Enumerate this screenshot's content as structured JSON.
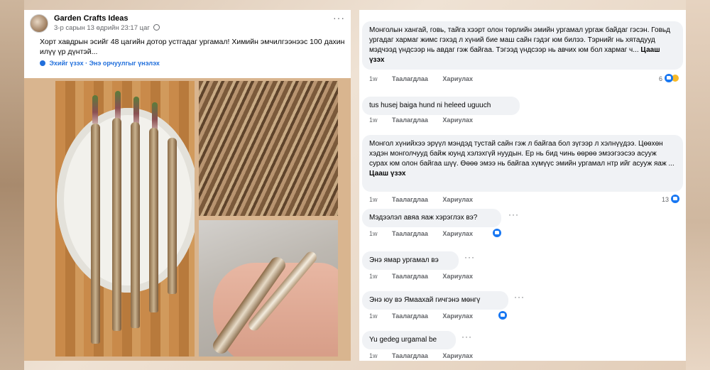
{
  "post": {
    "page_name": "Garden Crafts Ideas",
    "timestamp": "3-р сарын 13 өдрийн 23:17 цаг",
    "text": "Хорт хавдрын эсийг 48 цагийн дотор устгадаг ургамал! Химийн эмчилгээнээс 100 дахин илүү үр дүнтэй...",
    "translate_links": "Эхийг үзэх · Энэ орчуулгыг үнэлэх"
  },
  "comments": [
    {
      "text": "Монголын хангай, говь, тайга хээрт олон төрлийн эмийн ургамал ургаж байдаг гэсэн. Говьд ургадаг хармаг жимс гэхэд л хүний бие маш сайн гэдэг юм билээ. Тэрнийг нь хятадууд мэдчээд үндсээр нь авдаг гэж байгаа. Тэгээд үндсээр нь авчих юм бол хармаг ч...",
      "more": "Цааш үзэх",
      "time": "1w",
      "like": "Таалагдлаа",
      "reply": "Хариулах",
      "reactions": "6"
    },
    {
      "text": "tus husej baiga hund ni heleed uguuch",
      "time": "1w",
      "like": "Таалагдлаа",
      "reply": "Хариулах"
    },
    {
      "text": "Монгол хүнийхээ эрүүл мэндэд тустай сайн гэж л байгаа бол зүгээр л хэлнүүдээ. Цөөхөн хэдэн монголчууд байж юунд хэлэхгүй нуудын. Ер нь бид чинь өөрөө эмээгээсээ асууж сурах юм олон байгаа шүү. Өөөө эмээ нь байгаа хүмүүс эмийн ургамал нтр ийг асууж яаж ...",
      "more": "Цааш үзэх",
      "time": "1w",
      "like": "Таалагдлаа",
      "reply": "Хариулах",
      "reactions": "13"
    },
    {
      "text": "Мэдээлэл авяа яаж хэрэглэх вэ?",
      "time": "1w",
      "like": "Таалагдлаа",
      "reply": "Хариулах"
    },
    {
      "text": "Энэ ямар ургамал вэ",
      "time": "1w",
      "like": "Таалагдлаа",
      "reply": "Хариулах"
    },
    {
      "text": "Энэ юу вэ Ямаахай гичгэнэ мөнгү",
      "time": "1w",
      "like": "Таалагдлаа",
      "reply": "Хариулах"
    },
    {
      "text": "Yu gedeg urgamal be",
      "time": "1w",
      "like": "Таалагдлаа",
      "reply": "Хариулах"
    }
  ],
  "icons": {
    "like": "thumbs-up-icon",
    "haha": "laughing-face-icon",
    "more": "ellipsis-icon",
    "globe": "globe-icon"
  },
  "colors": {
    "link_blue": "#216fdb",
    "like_blue": "#1877f2",
    "bubble_bg": "#f0f2f5",
    "meta_gray": "#65676b"
  }
}
